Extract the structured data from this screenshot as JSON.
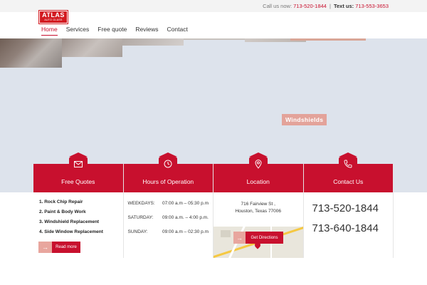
{
  "topbar": {
    "call_label": "Call us now:",
    "call_number": "713-520-1844",
    "separator": "|",
    "text_label": "Text us:",
    "text_number": "713-553-3653"
  },
  "logo": {
    "name": "ATLAS",
    "tagline": "AUTO GLASS"
  },
  "nav": {
    "items": [
      {
        "label": "Home"
      },
      {
        "label": "Services"
      },
      {
        "label": "Free quote"
      },
      {
        "label": "Reviews"
      },
      {
        "label": "Contact"
      }
    ]
  },
  "hero": {
    "tag": "Windshields"
  },
  "boxes": {
    "quotes": {
      "title": "Free Quotes",
      "icon": "envelope-icon",
      "items": [
        "1.  Rock Chip Repair",
        "2.  Paint & Body Work",
        "3.  Windshield Replacement",
        "4.  Side Window Replacement"
      ],
      "read_more": "Read more"
    },
    "hours": {
      "title": "Hours of Operation",
      "icon": "clock-icon",
      "rows": [
        {
          "day": "WEEKDAYS:",
          "time": "07:00 a.m – 05:30 p.m"
        },
        {
          "day": "SATURDAY:",
          "time": "09:00 a.m. – 4:00 p.m."
        },
        {
          "day": "SUNDAY:",
          "time": "09:00 a.m – 02:30 p.m"
        }
      ]
    },
    "location": {
      "title": "Location",
      "icon": "map-pin-icon",
      "line1": "716 Fairview St ,",
      "line2": "Houston, Texas 77006",
      "directions": "Get Directions"
    },
    "contact": {
      "title": "Contact Us",
      "icon": "phone-icon",
      "phone1": "713-520-1844",
      "phone2": "713-640-1844"
    }
  },
  "colors": {
    "accent": "#c8102e",
    "accent_light": "#e8a69e",
    "hero_bg": "#dde3ec"
  }
}
